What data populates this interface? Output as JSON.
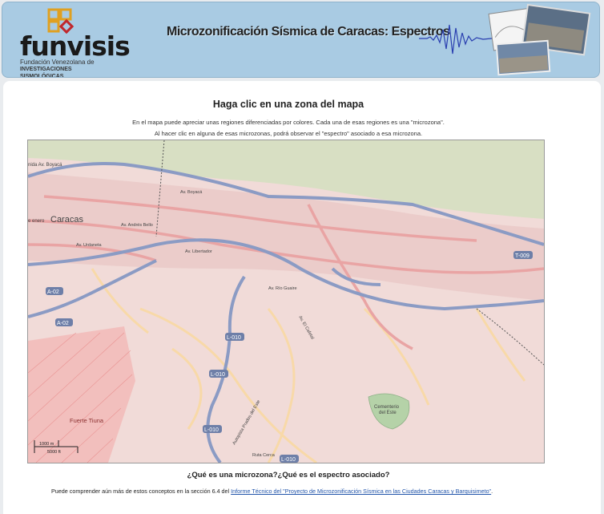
{
  "header": {
    "logo_text": "funvisis",
    "logo_sub_line1": "Fundación Venezolana de",
    "logo_sub_line2": "INVESTIGACIONES SISMOLÓGICAS",
    "title": "Microzonificación Sísmica de Caracas: Espectros"
  },
  "main": {
    "heading": "Haga clic en una zona del mapa",
    "intro_line1": "En el mapa puede apreciar unas regiones diferenciadas por colores. Cada una de esas regiones es una \"microzona\".",
    "intro_line2": "Al hacer clic en alguna de esas microzonas, podrá observar el \"espectro\" asociado a esa microzona."
  },
  "map": {
    "labels": {
      "city": "Caracas",
      "fuerte": "Fuerte Tiuna",
      "cementerio1": "Cementerio",
      "cementerio2": "del Este",
      "enero": "e enero",
      "boyaca": "nida Av. Boyacá",
      "av_andres_bello": "Av. Andrés Bello",
      "av_libertador": "Av. Libertador",
      "av_urdaneta": "Av. Urdaneta",
      "av_boyaca2": "Av. Boyacá",
      "av_el_cafetal": "Av. El Cafetal",
      "autopista_prados": "Autopista Prados del Este",
      "av_rio": "Av. Río Guaire",
      "ruta_cerca": "Ruta Cerca"
    },
    "shields": {
      "a02_top": "A-02",
      "a02_mid": "A-02",
      "l010_1": "L-010",
      "l010_2": "L-010",
      "l010_3": "L-010",
      "l010_4": "L-010",
      "t009": "T-009"
    },
    "scale": {
      "metric": "1000 m",
      "imperial": "5000 ft"
    },
    "colors": {
      "land": "#f1dbd8",
      "mountains": "#d8dfc3",
      "highway": "#8b9bc4",
      "primary": "#e9a4a4",
      "secondary": "#f8d9a8",
      "urban": "#e8c6c4",
      "military": "#f2a8a8"
    }
  },
  "questions": {
    "title": "¿Qué es una microzona?¿Qué es el espectro asociado?",
    "foot_prefix": "Puede comprender aún más de estos conceptos en la sección 6.4 del ",
    "foot_link": "Informe Técnico del \"Proyecto de Microzonificación Sísmica en las Ciudades Caracas y Barquisimeto\"",
    "foot_suffix": "."
  }
}
